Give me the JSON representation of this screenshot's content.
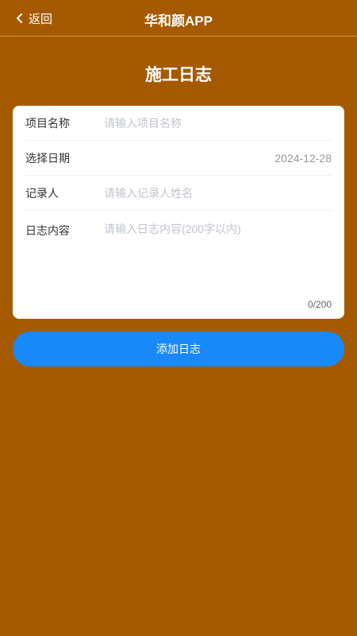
{
  "nav": {
    "back_label": "返回",
    "title": "华和颜APP",
    "back_icon": "chevron-left-icon"
  },
  "page": {
    "title": "施工日志"
  },
  "form": {
    "project": {
      "label": "项目名称",
      "placeholder": "请输入项目名称",
      "value": ""
    },
    "date": {
      "label": "选择日期",
      "value": "2024-12-28"
    },
    "recorder": {
      "label": "记录人",
      "placeholder": "请输入记录人姓名",
      "value": ""
    },
    "content": {
      "label": "日志内容",
      "placeholder": "请输入日志内容(200字以内)",
      "value": "",
      "counter": "0/200"
    }
  },
  "submit": {
    "label": "添加日志"
  },
  "colors": {
    "background": "#a65a00",
    "primary": "#1989fa",
    "card": "#ffffff"
  }
}
